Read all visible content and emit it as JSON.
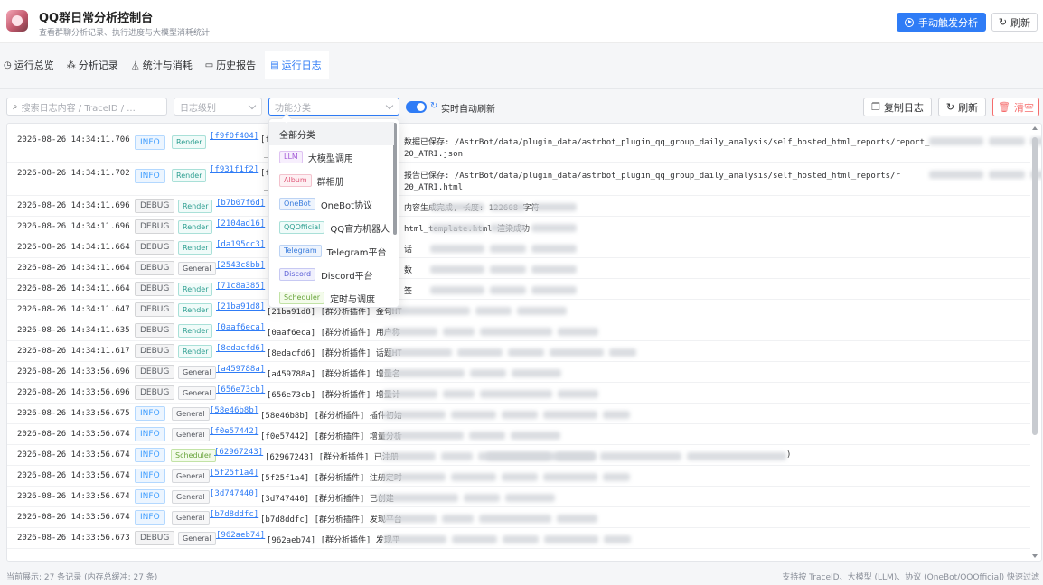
{
  "header": {
    "title": "QQ群日常分析控制台",
    "subtitle": "查看群聊分析记录、执行进度与大模型消耗统计",
    "trigger_label": "手动触发分析",
    "refresh_label": "刷新"
  },
  "tabs": [
    {
      "label": "运行总览",
      "icon": "clock-icon"
    },
    {
      "label": "分析记录",
      "icon": "nodes-icon"
    },
    {
      "label": "统计与消耗",
      "icon": "flask-icon"
    },
    {
      "label": "历史报告",
      "icon": "folder-icon"
    },
    {
      "label": "运行日志",
      "icon": "document-icon",
      "active": true
    }
  ],
  "toolbar": {
    "search_placeholder": "搜索日志内容 / TraceID / ...",
    "level_placeholder": "日志级别",
    "category_placeholder": "功能分类",
    "auto_refresh_label": "实时自动刷新",
    "auto_refresh_on": true,
    "copy_label": "复制日志",
    "refresh_label": "刷新",
    "clear_label": "清空"
  },
  "category_dropdown": {
    "options": [
      {
        "chip": "",
        "label": "全部分类",
        "selected": true
      },
      {
        "chip": "LLM",
        "label": "大模型调用",
        "color": "#a35ad6",
        "bg": "#f7effd",
        "border": "#dfc3f2"
      },
      {
        "chip": "Album",
        "label": "群相册",
        "color": "#e05a7a",
        "bg": "#fdf0f3",
        "border": "#f3c2cd"
      },
      {
        "chip": "OneBot",
        "label": "OneBot协议",
        "color": "#3b7ddd",
        "bg": "#eef4fd",
        "border": "#bcd3f4"
      },
      {
        "chip": "QQOfficial",
        "label": "QQ官方机器人",
        "color": "#2a9d8f",
        "bg": "#f0fbf9",
        "border": "#a9e0d8"
      },
      {
        "chip": "Telegram",
        "label": "Telegram平台",
        "color": "#3b7ddd",
        "bg": "#eef4fd",
        "border": "#bcd3f4"
      },
      {
        "chip": "Discord",
        "label": "Discord平台",
        "color": "#5b5fd6",
        "bg": "#f0f0fd",
        "border": "#c7c9f3"
      },
      {
        "chip": "Scheduler",
        "label": "定时与调度",
        "color": "#67a33a",
        "bg": "#f3fbea",
        "border": "#c2e3a6"
      }
    ]
  },
  "logs": [
    {
      "time": "2026-08-26 14:34:11.706",
      "level": "INFO",
      "category": "Render",
      "trace": "[f9f0f404]",
      "msg": "[f",
      "msg2": "数据已保存: /AstrBot/data/plugin_data/astrbot_plugin_qq_group_daily_analysis/self_hosted_html_reports/report_",
      "msg3": "_1",
      "msg4": "20_ATRI.json",
      "tall": true
    },
    {
      "time": "2026-08-26 14:34:11.702",
      "level": "INFO",
      "category": "Render",
      "trace": "[f931f1f2]",
      "msg": "[f",
      "msg2": "报告已保存: /AstrBot/data/plugin_data/astrbot_plugin_qq_group_daily_analysis/self_hosted_html_reports/r",
      "msg3": "_1",
      "msg4": "20_ATRI.html",
      "tall": true
    },
    {
      "time": "2026-08-26 14:34:11.696",
      "level": "DEBUG",
      "category": "Render",
      "trace": "[b7b07f6d]",
      "msg": "[",
      "msg2": "内容生成完成, 长度: 122608 字符"
    },
    {
      "time": "2026-08-26 14:34:11.696",
      "level": "DEBUG",
      "category": "Render",
      "trace": "[2104ad16]",
      "msg": "[",
      "msg2": "html_template.html 渲染成功"
    },
    {
      "time": "2026-08-26 14:34:11.664",
      "level": "DEBUG",
      "category": "Render",
      "trace": "[da195cc3]",
      "msg": "[",
      "msg2": "话"
    },
    {
      "time": "2026-08-26 14:34:11.664",
      "level": "DEBUG",
      "category": "General",
      "trace": "[2543c8bb]",
      "msg": "[",
      "msg2": "数"
    },
    {
      "time": "2026-08-26 14:34:11.664",
      "level": "DEBUG",
      "category": "Render",
      "trace": "[71c8a385]",
      "msg": "[",
      "msg2": "签"
    },
    {
      "time": "2026-08-26 14:34:11.647",
      "level": "DEBUG",
      "category": "Render",
      "trace": "[21ba91d8]",
      "msg": "[21ba91d8] [群分析插件] 金句HT"
    },
    {
      "time": "2026-08-26 14:34:11.635",
      "level": "DEBUG",
      "category": "Render",
      "trace": "[0aaf6eca]",
      "msg": "[0aaf6eca] [群分析插件] 用户称"
    },
    {
      "time": "2026-08-26 14:34:11.617",
      "level": "DEBUG",
      "category": "Render",
      "trace": "[8edacfd6]",
      "msg": "[8edacfd6] [群分析插件] 话题HT"
    },
    {
      "time": "2026-08-26 14:33:56.696",
      "level": "DEBUG",
      "category": "General",
      "trace": "[a459788a]",
      "msg": "[a459788a] [群分析插件] 增量名"
    },
    {
      "time": "2026-08-26 14:33:56.696",
      "level": "DEBUG",
      "category": "General",
      "trace": "[656e73cb]",
      "msg": "[656e73cb] [群分析插件] 增量计"
    },
    {
      "time": "2026-08-26 14:33:56.675",
      "level": "INFO",
      "category": "General",
      "trace": "[58e46b8b]",
      "msg": "[58e46b8b] [群分析插件] 插件初始"
    },
    {
      "time": "2026-08-26 14:33:56.674",
      "level": "INFO",
      "category": "General",
      "trace": "[f0e57442]",
      "msg": "[f0e57442] [群分析插件] 增量分析"
    },
    {
      "time": "2026-08-26 14:33:56.674",
      "level": "INFO",
      "category": "Scheduler",
      "trace": "[62967243]",
      "msg": "[62967243] [群分析插件] 已注册",
      "tail": ")"
    },
    {
      "time": "2026-08-26 14:33:56.674",
      "level": "INFO",
      "category": "General",
      "trace": "[5f25f1a4]",
      "msg": "[5f25f1a4] [群分析插件] 注册定时"
    },
    {
      "time": "2026-08-26 14:33:56.674",
      "level": "INFO",
      "category": "General",
      "trace": "[3d747440]",
      "msg": "[3d747440] [群分析插件] 已创建"
    },
    {
      "time": "2026-08-26 14:33:56.674",
      "level": "INFO",
      "category": "General",
      "trace": "[b7d8ddfc]",
      "msg": "[b7d8ddfc] [群分析插件] 发现平台"
    },
    {
      "time": "2026-08-26 14:33:56.673",
      "level": "DEBUG",
      "category": "General",
      "trace": "[962aeb74]",
      "msg": "[962aeb74] [群分析插件] 发现平"
    }
  ],
  "footer": {
    "left": "当前展示: 27 条记录 (内存总缓冲: 27 条)",
    "right": "支持按 TraceID、大模型 (LLM)、协议 (OneBot/QQOfficial) 快速过滤"
  }
}
